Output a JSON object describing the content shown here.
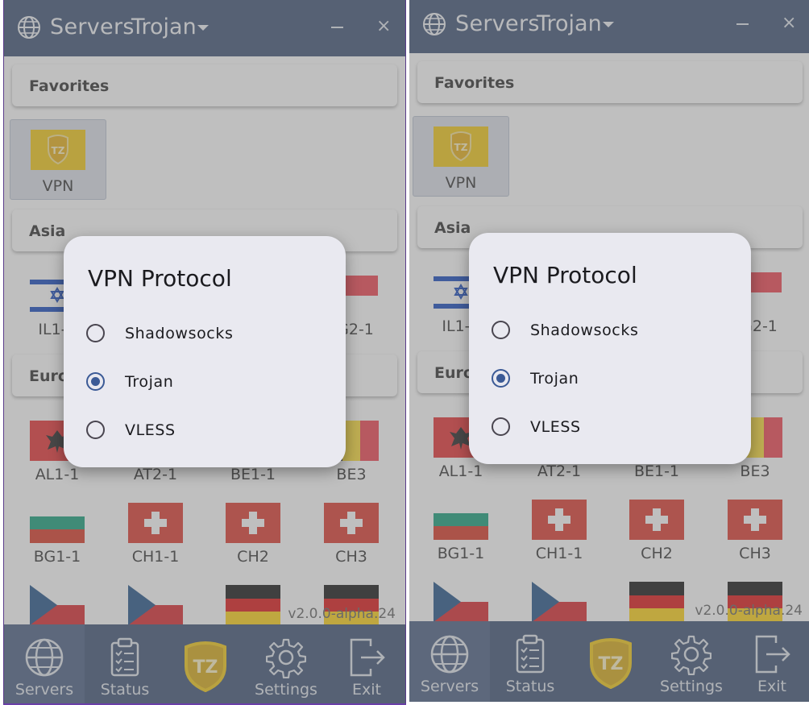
{
  "titlebar": {
    "title": "Servers",
    "protocol": "Trojan",
    "minimize": "–",
    "close": "×"
  },
  "sections": {
    "favorites": "Favorites",
    "asia": "Asia",
    "europe": "Europe"
  },
  "favorites": [
    {
      "label": "VPN",
      "icon": "trojan-logo-icon"
    }
  ],
  "asia_servers": [
    {
      "label": "IL1-1",
      "flag": "israel-flag-icon"
    },
    {
      "label": "SG2-1",
      "flag": "singapore-flag-icon"
    }
  ],
  "europe_servers": [
    {
      "label": "AL1-1",
      "flag": "albania-flag-icon"
    },
    {
      "label": "AT2-1",
      "flag": "austria-flag-icon"
    },
    {
      "label": "BE1-1",
      "flag": "belgium-flag-icon"
    },
    {
      "label": "BE3",
      "flag": "belgium-flag-icon"
    },
    {
      "label": "BG1-1",
      "flag": "bulgaria-flag-icon"
    },
    {
      "label": "CH1-1",
      "flag": "switzerland-flag-icon"
    },
    {
      "label": "CH2",
      "flag": "switzerland-flag-icon"
    },
    {
      "label": "CH3",
      "flag": "switzerland-flag-icon"
    },
    {
      "label": "",
      "flag": "czech-flag-icon"
    },
    {
      "label": "",
      "flag": "czech-flag-icon"
    },
    {
      "label": "",
      "flag": "germany-flag-icon"
    },
    {
      "label": "",
      "flag": "germany-flag-icon"
    }
  ],
  "version": "v2.0.0-alpha.24",
  "nav": {
    "servers": "Servers",
    "status": "Status",
    "settings": "Settings",
    "exit": "Exit",
    "active": "servers"
  },
  "dialog": {
    "title": "VPN Protocol",
    "options": [
      "Shadowsocks",
      "Trojan",
      "VLESS"
    ],
    "selected": "Trojan"
  },
  "colors": {
    "header_bg": "#2d4368",
    "accent": "#3b5a96",
    "dialog_bg": "#e9e9f0",
    "logo_yellow": "#f2c500"
  }
}
